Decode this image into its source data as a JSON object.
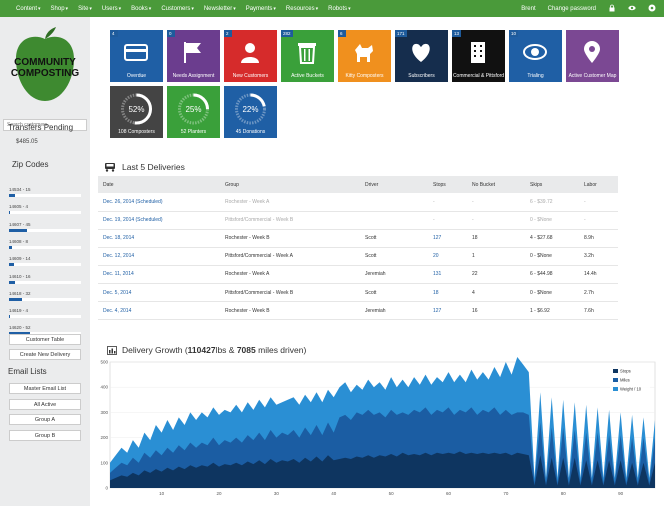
{
  "nav": {
    "menu": [
      "Content",
      "Shop",
      "Site",
      "Users",
      "Books",
      "Customers",
      "Newsletter",
      "Payments",
      "Resources",
      "Robots"
    ],
    "user": "Brent",
    "change_password": "Change password"
  },
  "sidebar": {
    "logo_line1": "COMMUNITY",
    "logo_line2": "COMPOSTING",
    "search_placeholder": "Search customers...",
    "transfers_title": "Transfers Pending",
    "transfers_value": "$485.05",
    "zip_title": "Zip Codes",
    "zips": [
      {
        "label": "14534 - 15",
        "pct": 0.08
      },
      {
        "label": "14605 - 4",
        "pct": 0.02
      },
      {
        "label": "14607 - 45",
        "pct": 0.25
      },
      {
        "label": "14608 - 8",
        "pct": 0.04
      },
      {
        "label": "14609 - 14",
        "pct": 0.07
      },
      {
        "label": "14610 - 16",
        "pct": 0.09
      },
      {
        "label": "14618 - 32",
        "pct": 0.18
      },
      {
        "label": "14619 - 4",
        "pct": 0.02
      },
      {
        "label": "14620 - 52",
        "pct": 0.29
      }
    ],
    "customer_table": "Customer Table",
    "create_delivery": "Create New Delivery",
    "email_title": "Email Lists",
    "email_lists": [
      "Master Email List",
      "All Active",
      "Group A",
      "Group B"
    ]
  },
  "tiles": [
    {
      "badge": "4",
      "label": "Overdue",
      "color": "#1f5fa5",
      "icon": "credit-card-icon"
    },
    {
      "badge": "0",
      "label": "Needs Assignment",
      "color": "#6b3d8e",
      "icon": "flag-icon"
    },
    {
      "badge": "2",
      "label": "New Customers",
      "color": "#d62b2b",
      "icon": "user-icon"
    },
    {
      "badge": "282",
      "label": "Active Buckets",
      "color": "#3aa03a",
      "icon": "trash-icon"
    },
    {
      "badge": "6",
      "label": "Kitty Composters",
      "color": "#f0901e",
      "icon": "dog-icon"
    },
    {
      "badge": "171",
      "label": "Subscribers",
      "color": "#152d4d",
      "icon": "heart-icon"
    },
    {
      "badge": "13",
      "label": "Commercial & Pittsford",
      "color": "#111111",
      "icon": "building-icon"
    },
    {
      "badge": "10",
      "label": "Trialing",
      "color": "#1f5fa5",
      "icon": "eye-icon"
    },
    {
      "badge": "",
      "label": "Active Customer Map",
      "color": "#7b4893",
      "icon": "map-pin-icon"
    }
  ],
  "rings": [
    {
      "pct": "52%",
      "label": "108 Composters",
      "color": "#444",
      "fraction": 0.52
    },
    {
      "pct": "25%",
      "label": "52 Planters",
      "color": "#3aa03a",
      "fraction": 0.25
    },
    {
      "pct": "22%",
      "label": "45 Donations",
      "color": "#1f5fa5",
      "fraction": 0.22
    }
  ],
  "deliveries": {
    "title": "Last 5 Deliveries",
    "headers": [
      "Date",
      "Group",
      "Driver",
      "Stops",
      "No Bucket",
      "Skips",
      "Labor"
    ],
    "rows": [
      {
        "sched": true,
        "cells": [
          "Dec. 26, 2014 (Scheduled)",
          "Rochester - Week A",
          "",
          "-",
          "-",
          "6 - $39.72",
          "-"
        ]
      },
      {
        "sched": true,
        "cells": [
          "Dec. 19, 2014 (Scheduled)",
          "Pittsford/Commercial - Week B",
          "",
          "-",
          "-",
          "0 - $None",
          "-"
        ]
      },
      {
        "sched": false,
        "cells": [
          "Dec. 18, 2014",
          "Rochester - Week B",
          "Scott",
          "127",
          "18",
          "4 - $27.68",
          "8.9h"
        ]
      },
      {
        "sched": false,
        "cells": [
          "Dec. 12, 2014",
          "Pittsford/Commercial - Week A",
          "Scott",
          "20",
          "1",
          "0 - $None",
          "3.2h"
        ]
      },
      {
        "sched": false,
        "cells": [
          "Dec. 11, 2014",
          "Rochester - Week A",
          "Jeremiah",
          "131",
          "22",
          "6 - $44.98",
          "14.4h"
        ]
      },
      {
        "sched": false,
        "cells": [
          "Dec. 5, 2014",
          "Pittsford/Commercial - Week B",
          "Scott",
          "18",
          "4",
          "0 - $None",
          "2.7h"
        ]
      },
      {
        "sched": false,
        "cells": [
          "Dec. 4, 2014",
          "Rochester - Week B",
          "Jeremiah",
          "127",
          "16",
          "1 - $6.92",
          "7.6h"
        ]
      }
    ]
  },
  "growth": {
    "title_prefix": "Delivery Growth (",
    "lbs": "110427",
    "mid": "lbs & ",
    "miles": "7085",
    "suffix": " miles driven)"
  },
  "chart_data": {
    "type": "area",
    "title": "Delivery Growth (110427lbs & 7085 miles driven)",
    "ylim": [
      0,
      500
    ],
    "yticks": [
      0,
      100,
      200,
      300,
      400,
      500
    ],
    "xticks": [
      10,
      20,
      30,
      40,
      50,
      60,
      70,
      80,
      90
    ],
    "xlim": [
      1,
      96
    ],
    "legend_position": "top-right",
    "series": [
      {
        "name": "Stops",
        "color": "#0e3560"
      },
      {
        "name": "Miles",
        "color": "#1b5da3"
      },
      {
        "name": "Weight / 10",
        "color": "#2a8fd4"
      }
    ],
    "x": [
      1,
      2,
      3,
      4,
      5,
      6,
      7,
      8,
      9,
      10,
      11,
      12,
      13,
      14,
      15,
      16,
      17,
      18,
      19,
      20,
      21,
      22,
      23,
      24,
      25,
      26,
      27,
      28,
      29,
      30,
      31,
      32,
      33,
      34,
      35,
      36,
      37,
      38,
      39,
      40,
      41,
      42,
      43,
      44,
      45,
      46,
      47,
      48,
      49,
      50,
      51,
      52,
      53,
      54,
      55,
      56,
      57,
      58,
      59,
      60,
      61,
      62,
      63,
      64,
      65,
      66,
      67,
      68,
      69,
      70,
      71,
      72,
      73,
      74,
      75,
      76,
      77,
      78,
      79,
      80,
      81,
      82,
      83,
      84,
      85,
      86,
      87,
      88,
      89,
      90,
      91,
      92,
      93,
      94,
      95,
      96
    ],
    "stops": [
      30,
      40,
      50,
      45,
      60,
      50,
      70,
      60,
      75,
      65,
      80,
      70,
      85,
      75,
      90,
      80,
      90,
      85,
      100,
      85,
      95,
      90,
      100,
      90,
      105,
      95,
      110,
      95,
      115,
      100,
      110,
      105,
      115,
      100,
      120,
      105,
      125,
      105,
      130,
      110,
      115,
      120,
      115,
      125,
      120,
      130,
      120,
      130,
      125,
      135,
      125,
      140,
      130,
      135,
      130,
      140,
      130,
      140,
      135,
      140,
      135,
      145,
      135,
      140,
      135,
      140,
      135,
      140,
      135,
      140,
      130,
      140,
      135,
      130,
      10,
      130,
      10,
      120,
      10,
      120,
      10,
      120,
      10,
      110,
      10,
      110,
      10,
      110,
      10,
      110,
      10,
      100,
      10,
      100,
      10,
      100
    ],
    "miles": [
      60,
      80,
      100,
      90,
      120,
      100,
      140,
      120,
      150,
      130,
      160,
      140,
      170,
      150,
      180,
      160,
      180,
      170,
      200,
      170,
      190,
      180,
      200,
      180,
      210,
      190,
      220,
      190,
      230,
      200,
      220,
      210,
      230,
      200,
      240,
      210,
      250,
      210,
      260,
      220,
      280,
      290,
      270,
      300,
      290,
      310,
      290,
      300,
      280,
      310,
      290,
      300,
      290,
      310,
      300,
      320,
      290,
      310,
      300,
      320,
      290,
      310,
      300,
      320,
      290,
      310,
      300,
      320,
      290,
      310,
      290,
      300,
      300,
      290,
      20,
      260,
      20,
      240,
      20,
      240,
      20,
      230,
      20,
      220,
      20,
      220,
      20,
      210,
      20,
      210,
      20,
      200,
      20,
      200,
      20,
      200
    ],
    "weight": [
      100,
      130,
      160,
      140,
      190,
      160,
      220,
      190,
      250,
      220,
      270,
      230,
      280,
      250,
      300,
      270,
      300,
      280,
      320,
      290,
      310,
      300,
      330,
      300,
      340,
      310,
      350,
      320,
      360,
      330,
      340,
      350,
      360,
      330,
      370,
      340,
      380,
      340,
      390,
      360,
      400,
      420,
      380,
      410,
      390,
      430,
      400,
      420,
      390,
      440,
      400,
      430,
      400,
      440,
      410,
      450,
      410,
      440,
      420,
      460,
      420,
      450,
      420,
      470,
      430,
      460,
      430,
      480,
      440,
      500,
      450,
      520,
      490,
      460,
      40,
      380,
      40,
      360,
      40,
      350,
      40,
      340,
      40,
      330,
      40,
      320,
      40,
      310,
      40,
      300,
      40,
      290,
      40,
      280,
      40,
      270
    ]
  }
}
